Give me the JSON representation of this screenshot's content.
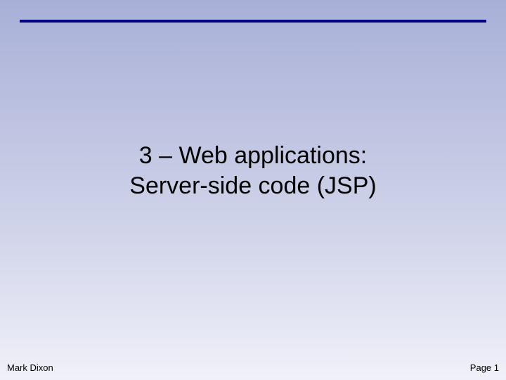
{
  "title": {
    "line1": "3 – Web applications:",
    "line2": "Server-side code (JSP)"
  },
  "footer": {
    "author": "Mark Dixon",
    "page_label": "Page 1"
  }
}
